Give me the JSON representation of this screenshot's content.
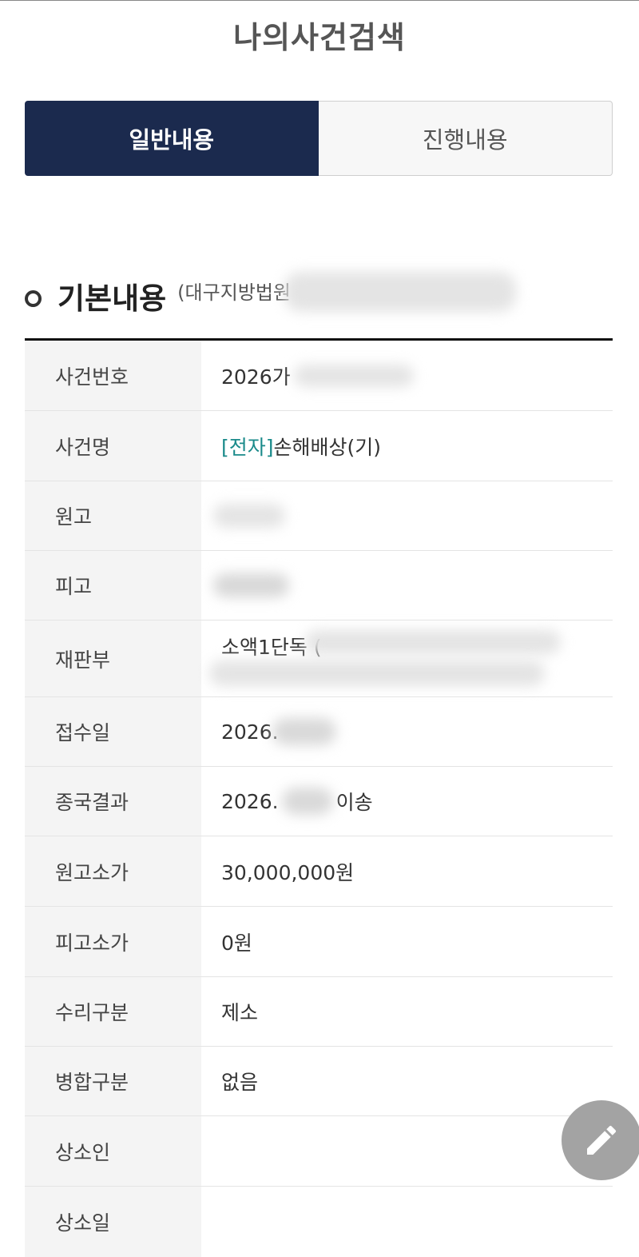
{
  "header": {
    "title": "나의사건검색"
  },
  "tabs": [
    {
      "label": "일반내용",
      "active": true
    },
    {
      "label": "진행내용",
      "active": false
    }
  ],
  "section": {
    "title": "기본내용",
    "court_prefix": "(대구지방법원"
  },
  "rows": [
    {
      "label": "사건번호",
      "value": "2026가"
    },
    {
      "label": "사건명",
      "tag": "[전자]",
      "value": "손해배상(기)"
    },
    {
      "label": "원고",
      "value": ""
    },
    {
      "label": "피고",
      "value": ""
    },
    {
      "label": "재판부",
      "value": "소액1단독 ("
    },
    {
      "label": "접수일",
      "value": "2026."
    },
    {
      "label": "종국결과",
      "value": "2026.",
      "suffix": "이송"
    },
    {
      "label": "원고소가",
      "value": "30,000,000원"
    },
    {
      "label": "피고소가",
      "value": "0원"
    },
    {
      "label": "수리구분",
      "value": "제소"
    },
    {
      "label": "병합구분",
      "value": "없음"
    },
    {
      "label": "상소인",
      "value": ""
    },
    {
      "label": "상소일",
      "value": ""
    }
  ],
  "colors": {
    "active_tab": "#1b2a4e",
    "tag": "#1a8a8a",
    "fab": "#a3a3a3"
  },
  "icons": {
    "fab": "pencil-icon",
    "bullet": "circle-bullet-icon"
  }
}
